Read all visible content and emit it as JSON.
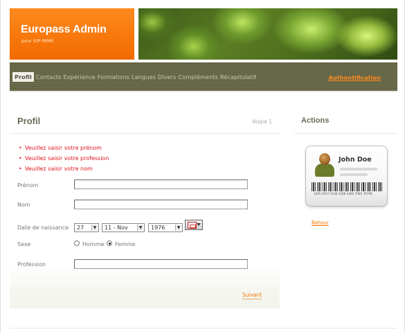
{
  "header": {
    "title": "Europass Admin",
    "subtitle": "pour IUP MIME"
  },
  "nav": {
    "items": [
      {
        "label": "Profil",
        "active": true
      },
      {
        "label": "Contacts",
        "active": false
      },
      {
        "label": "Expérience",
        "active": false
      },
      {
        "label": "Formations",
        "active": false
      },
      {
        "label": "Langues",
        "active": false
      },
      {
        "label": "Divers",
        "active": false
      },
      {
        "label": "Compléments",
        "active": false
      },
      {
        "label": "Récapitulatif",
        "active": false
      }
    ],
    "auth_label": "Authentification"
  },
  "main": {
    "title": "Profil",
    "step": "étape 1",
    "errors": [
      "Veuillez saisir votre prénom",
      "Veuillez saisir votre profession",
      "Veuillez saisir votre nom"
    ],
    "fields": {
      "prenom_label": "Prénom",
      "prenom_value": "",
      "nom_label": "Nom",
      "nom_value": "",
      "birth_label": "Date de naissance",
      "birth_day": "27",
      "birth_month": "11 - Nov",
      "birth_year": "1976",
      "sexe_label": "Sexe",
      "sexe_options": [
        "Homme",
        "Femme"
      ],
      "sexe_selected": "Femme",
      "profession_label": "Profession",
      "profession_value": ""
    },
    "next_label": "Suivant"
  },
  "sidebar": {
    "title": "Actions",
    "card_name": "John Doe",
    "barcode_number": "3245 0357 5106 5406 5465 7065 76799",
    "back_label": "Retour"
  },
  "colors": {
    "accent": "#f26a00",
    "nav_bg": "#6a6a4b",
    "error": "#e0141e"
  }
}
